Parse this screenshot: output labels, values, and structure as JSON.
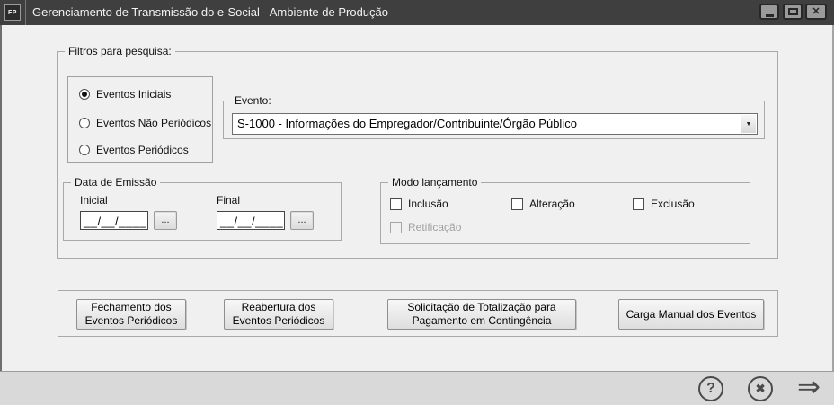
{
  "window": {
    "title": "Gerenciamento de Transmissão do e-Social - Ambiente de Produção",
    "icon_label": "FP",
    "close_glyph": "✕"
  },
  "filters": {
    "group_label": "Filtros para pesquisa:",
    "event_types": [
      {
        "label": "Eventos Iniciais",
        "selected": true
      },
      {
        "label": "Eventos Não Periódicos",
        "selected": false
      },
      {
        "label": "Eventos Periódicos",
        "selected": false
      }
    ],
    "evento": {
      "group_label": "Evento:",
      "selected_value": "S-1000 - Informações do Empregador/Contribuinte/Órgão Público",
      "dropdown_glyph": "▼"
    },
    "data_emissao": {
      "group_label": "Data de Emissão",
      "inicial_label": "Inicial",
      "final_label": "Final",
      "inicial_value": "__/__/____",
      "final_value": "__/__/____",
      "browse_label": "..."
    },
    "modo_lancamento": {
      "group_label": "Modo lançamento",
      "options": [
        {
          "label": "Inclusão",
          "checked": false,
          "enabled": true
        },
        {
          "label": "Alteração",
          "checked": false,
          "enabled": true
        },
        {
          "label": "Exclusão",
          "checked": false,
          "enabled": true
        },
        {
          "label": "Retificação",
          "checked": false,
          "enabled": false
        }
      ]
    }
  },
  "actions": [
    {
      "label": "Fechamento dos Eventos Periódicos"
    },
    {
      "label": "Reabertura dos Eventos Periódicos"
    },
    {
      "label": "Solicitação de Totalização para Pagamento em Contingência"
    },
    {
      "label": "Carga Manual dos Eventos"
    }
  ],
  "footer": {
    "help_glyph": "?",
    "cancel_glyph": "✖",
    "forward_glyph": "⇒"
  },
  "colors": {
    "titlebar_bg": "#3f3f3f",
    "window_bg": "#f0f0f0",
    "footer_bg": "#d9d9d9",
    "icon_color": "#4b4b4b"
  }
}
